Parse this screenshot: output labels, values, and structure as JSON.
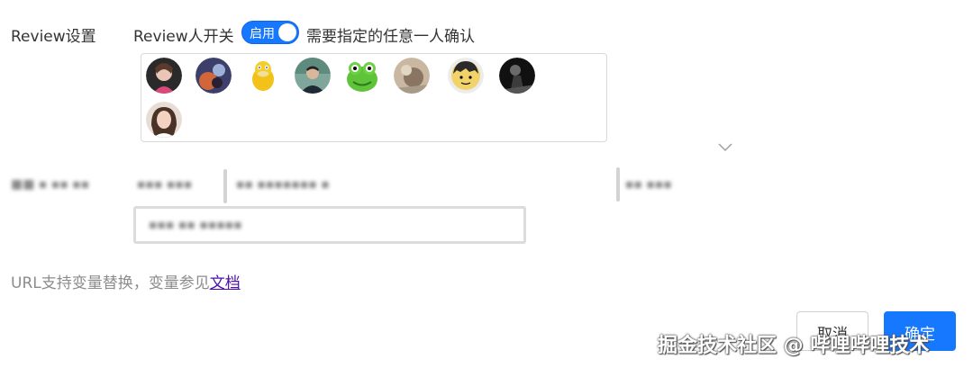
{
  "review": {
    "section_label": "Review设置",
    "switch_label": "Review人开关",
    "switch_state": "启用",
    "switch_on": true,
    "switch_note": "需要指定的任意一人确认"
  },
  "reviewers": {
    "count": 9
  },
  "url_hint": {
    "text": "URL支持变量替换，变量参见",
    "link": "文档"
  },
  "footer": {
    "cancel_label": "取消",
    "ok_label": "确定"
  },
  "watermark": "掘金技术社区 @ 哔哩哔哩技术",
  "colors": {
    "primary": "#1677ff",
    "link": "#4b0fa6"
  }
}
